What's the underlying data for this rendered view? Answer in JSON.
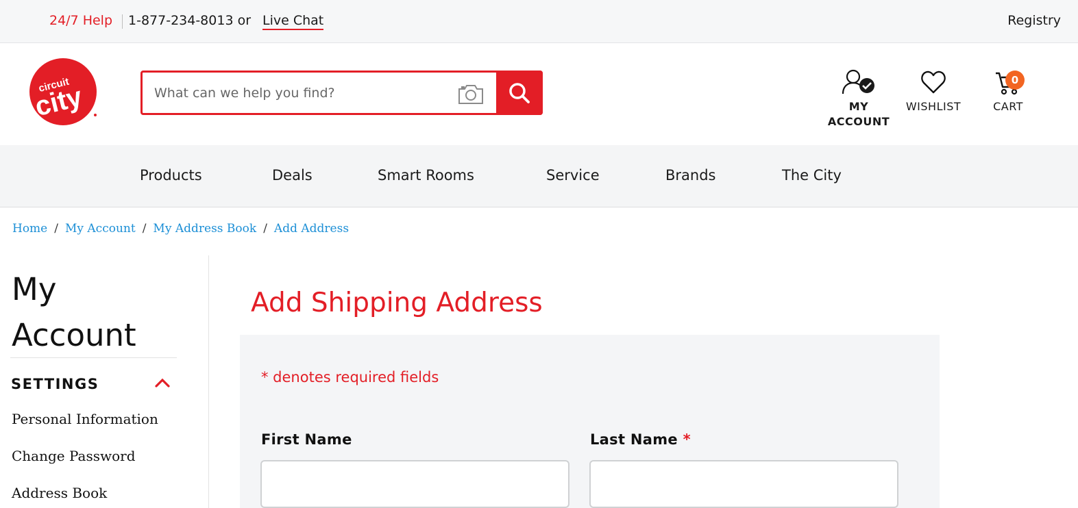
{
  "topbar": {
    "help": "24/7 Help",
    "phone": "1-877-234-8013 or",
    "live_chat": "Live Chat",
    "registry": "Registry"
  },
  "logo": {
    "line1": "circuit",
    "line2": "city"
  },
  "search": {
    "placeholder": "What can we help you find?"
  },
  "header": {
    "account_line1": "MY",
    "account_line2": "ACCOUNT",
    "wishlist": "WISHLIST",
    "cart": "CART",
    "cart_count": "0"
  },
  "nav": [
    "Products",
    "Deals",
    "Smart Rooms",
    "Service",
    "Brands",
    "The City"
  ],
  "breadcrumb": [
    "Home",
    "My Account",
    "My Address Book",
    "Add Address"
  ],
  "sidebar": {
    "title": "My Account",
    "section": "SETTINGS",
    "links": [
      "Personal Information",
      "Change Password",
      "Address Book"
    ]
  },
  "main": {
    "title": "Add Shipping Address",
    "required_note": "* denotes required fields",
    "first_name_label": "First Name",
    "last_name_label": "Last Name",
    "required_star": "*",
    "first_name_value": "",
    "last_name_value": ""
  },
  "colors": {
    "brand_red": "#e31e26",
    "link_blue": "#1c8fd6",
    "badge_orange": "#f26522"
  },
  "icons": [
    "circuit-city-logo",
    "camera-icon",
    "search-icon",
    "account-icon",
    "heart-icon",
    "cart-icon",
    "chevron-up-icon"
  ]
}
